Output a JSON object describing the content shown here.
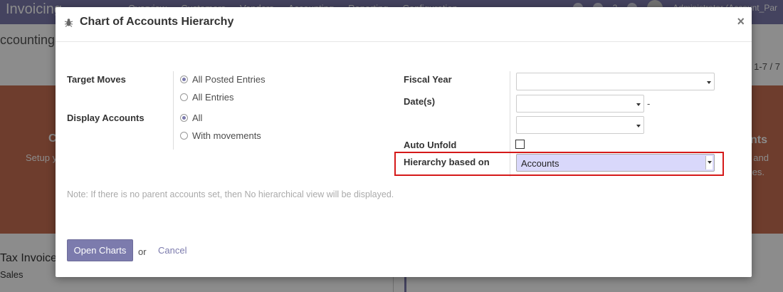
{
  "background": {
    "brand": "Invoicing",
    "menu": [
      "Overview",
      "Customers",
      "Vendors",
      "Accounting",
      "Reporting",
      "Configuration"
    ],
    "badge_count": "2",
    "user": "Administrator (Account_Par",
    "page_title": "ccounting G",
    "pager": "1-7 / 7",
    "hero_left_title": "C",
    "hero_left_sub": "Setup y",
    "hero_right_title": "nts",
    "hero_right_sub1": "unts and",
    "hero_right_sub2": "es.",
    "lower_title": "Tax Invoices",
    "lower_sub": "Sales"
  },
  "modal": {
    "title": "Chart of Accounts Hierarchy",
    "close_symbol": "×",
    "target_moves": {
      "label": "Target Moves",
      "options": [
        {
          "label": "All Posted Entries",
          "checked": true
        },
        {
          "label": "All Entries",
          "checked": false
        }
      ]
    },
    "display_accounts": {
      "label": "Display Accounts",
      "options": [
        {
          "label": "All",
          "checked": true
        },
        {
          "label": "With movements",
          "checked": false
        }
      ]
    },
    "fiscal_year": {
      "label": "Fiscal Year",
      "value": ""
    },
    "dates": {
      "label": "Date(s)",
      "from": "",
      "to": "",
      "separator": "-"
    },
    "auto_unfold": {
      "label": "Auto Unfold",
      "checked": false
    },
    "hierarchy": {
      "label": "Hierarchy based on",
      "value": "Accounts"
    },
    "note": "Note: If there is no parent accounts set, then No hierarchical view will be displayed.",
    "footer": {
      "open_label": "Open Charts",
      "or_text": "or",
      "cancel_label": "Cancel"
    }
  },
  "colors": {
    "accent": "#7c7bad",
    "highlight": "#d51919",
    "hero": "#c96f52"
  }
}
